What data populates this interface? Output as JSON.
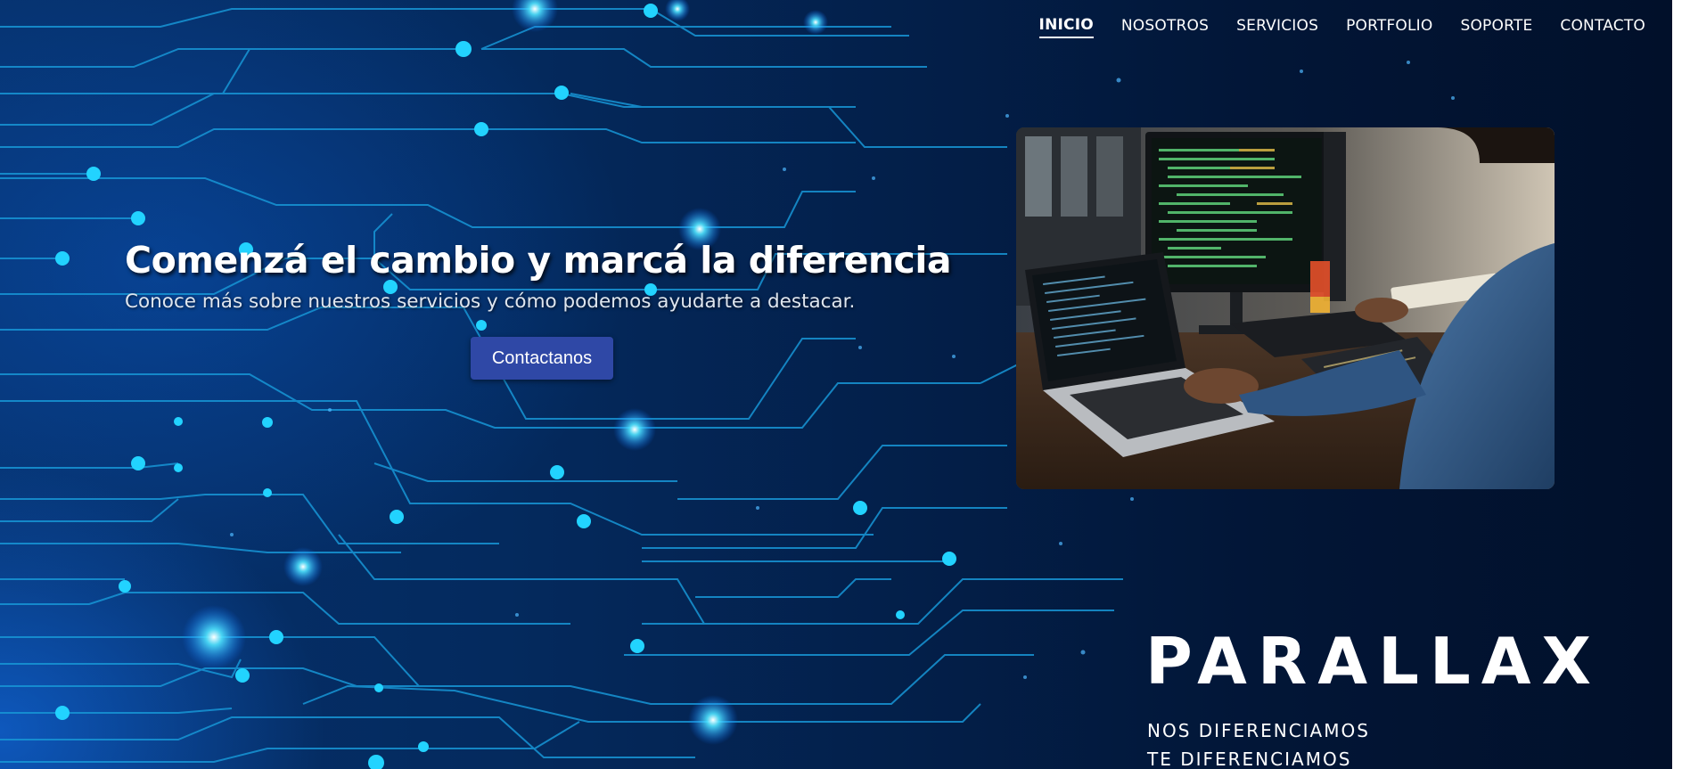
{
  "nav": {
    "items": [
      {
        "label": "INICIO",
        "active": true
      },
      {
        "label": "NOSOTROS",
        "active": false
      },
      {
        "label": "SERVICIOS",
        "active": false
      },
      {
        "label": "PORTFOLIO",
        "active": false
      },
      {
        "label": "SOPORTE",
        "active": false
      },
      {
        "label": "CONTACTO",
        "active": false
      }
    ]
  },
  "hero": {
    "title": "Comenzá el cambio y marcá la diferencia",
    "subtitle": "Conoce más sobre nuestros servicios y cómo podemos ayudarte a destacar.",
    "cta_label": "Contactanos"
  },
  "brand": {
    "name": "PARALLAX",
    "tagline_line1": "NOS DIFERENCIAMOS",
    "tagline_line2": "TE DIFERENCIAMOS"
  },
  "colors": {
    "background_dark": "#01102a",
    "background_blue": "#06316c",
    "circuit_line": "#1fa3e0",
    "circuit_node": "#22d3ff",
    "cta_button": "#2f48a6",
    "text": "#ffffff"
  },
  "image": {
    "subject": "developer-workspace-photo"
  }
}
